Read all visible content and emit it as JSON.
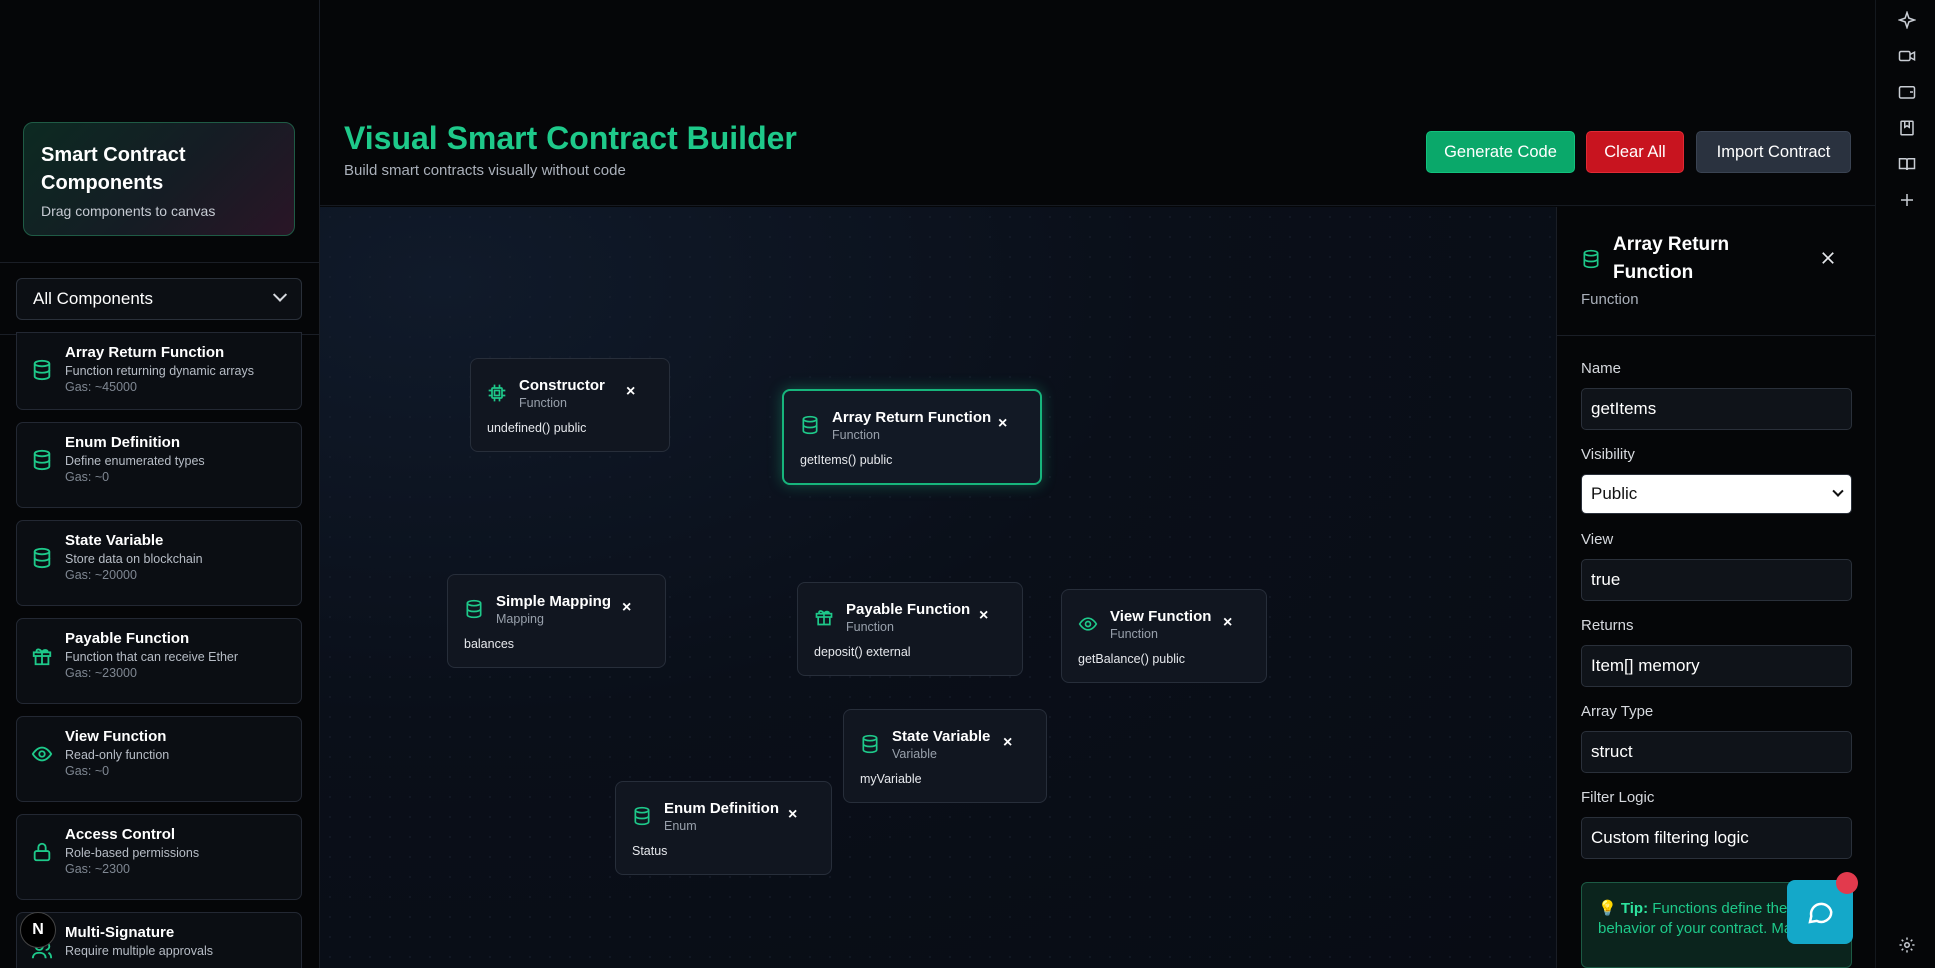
{
  "sidebar": {
    "title": "Smart Contract Components",
    "subtitle": "Drag components to canvas",
    "filter": "All Components",
    "items": [
      {
        "title": "Array Return Function",
        "desc": "Function returning dynamic arrays",
        "gas": "Gas: ~45000",
        "icon": "database-icon"
      },
      {
        "title": "Enum Definition",
        "desc": "Define enumerated types",
        "gas": "Gas: ~0",
        "icon": "database-icon"
      },
      {
        "title": "State Variable",
        "desc": "Store data on blockchain",
        "gas": "Gas: ~20000",
        "icon": "database-icon"
      },
      {
        "title": "Payable Function",
        "desc": "Function that can receive Ether",
        "gas": "Gas: ~23000",
        "icon": "gift-icon"
      },
      {
        "title": "View Function",
        "desc": "Read-only function",
        "gas": "Gas: ~0",
        "icon": "eye-icon"
      },
      {
        "title": "Access Control",
        "desc": "Role-based permissions",
        "gas": "Gas: ~2300",
        "icon": "lock-icon"
      },
      {
        "title": "Multi-Signature",
        "desc": "Require multiple approvals",
        "gas": "",
        "icon": "users-icon"
      }
    ]
  },
  "header": {
    "title": "Visual Smart Contract Builder",
    "subtitle": "Build smart contracts visually without code",
    "generate_label": "Generate Code",
    "clear_label": "Clear All",
    "import_label": "Import Contract"
  },
  "canvas": {
    "nodes": [
      {
        "title": "Constructor",
        "type": "Function",
        "sig": "undefined() public",
        "icon": "chip-icon"
      },
      {
        "title": "Array Return Function",
        "type": "Function",
        "sig": "getItems() public",
        "icon": "database-icon",
        "selected": true
      },
      {
        "title": "Simple Mapping",
        "type": "Mapping",
        "sig": "balances",
        "icon": "database-icon"
      },
      {
        "title": "Payable Function",
        "type": "Function",
        "sig": "deposit() external",
        "icon": "gift-icon"
      },
      {
        "title": "View Function",
        "type": "Function",
        "sig": "getBalance() public",
        "icon": "eye-icon"
      },
      {
        "title": "State Variable",
        "type": "Variable",
        "sig": "myVariable",
        "icon": "database-icon"
      },
      {
        "title": "Enum Definition",
        "type": "Enum",
        "sig": "Status",
        "icon": "database-icon"
      }
    ],
    "close_glyph": "×"
  },
  "properties": {
    "title": "Array Return Function",
    "type": "Function",
    "fields": [
      {
        "label": "Name",
        "value": "getItems"
      },
      {
        "label": "Visibility",
        "value": "Public"
      },
      {
        "label": "View",
        "value": "true"
      },
      {
        "label": "Returns",
        "value": "Item[] memory"
      },
      {
        "label": "Array Type",
        "value": "struct"
      },
      {
        "label": "Filter Logic",
        "value": "Custom filtering logic"
      }
    ],
    "tip_label": "💡 Tip:",
    "tip_text": " Functions define the behavior of your contract. Make"
  },
  "logo_letter": "N",
  "colors": {
    "accent": "#1ec98a",
    "danger": "#c8141f",
    "neutral": "#2a323f",
    "chat": "#14a8c9"
  }
}
